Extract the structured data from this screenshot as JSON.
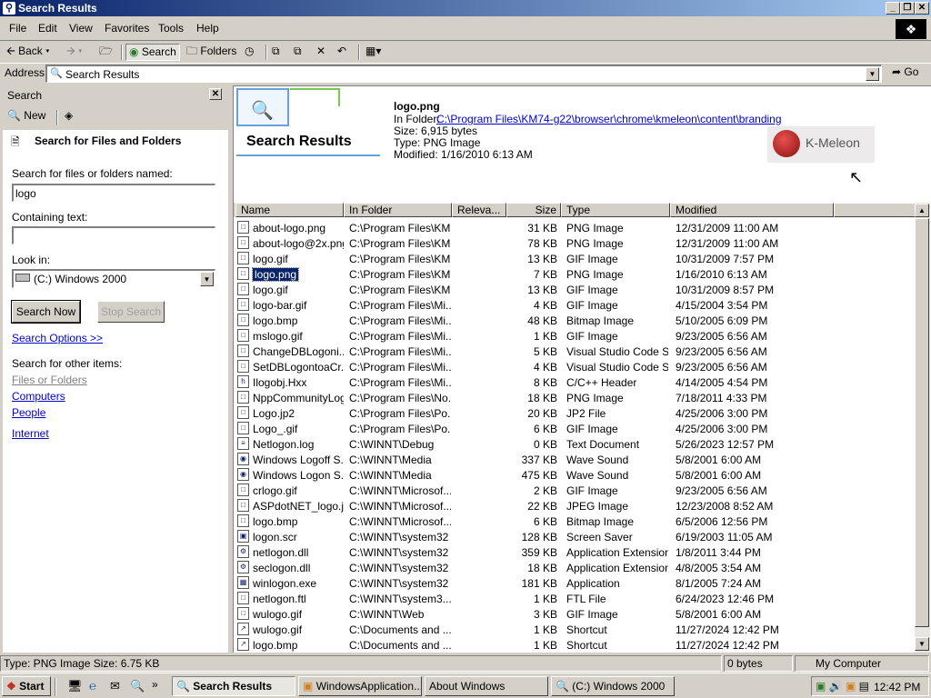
{
  "window": {
    "title": "Search Results"
  },
  "menu": [
    "File",
    "Edit",
    "View",
    "Favorites",
    "Tools",
    "Help"
  ],
  "toolbar": {
    "back": "Back",
    "search": "Search",
    "folders": "Folders"
  },
  "address": {
    "label": "Address",
    "value": "Search Results",
    "go": "Go"
  },
  "search_pane": {
    "header": "Search",
    "new_label": "New",
    "heading": "Search for Files and Folders",
    "named_label": "Search for files or folders named:",
    "named_value": "logo",
    "containing_label": "Containing text:",
    "containing_value": "",
    "lookin_label": "Look in:",
    "lookin_value": "(C:) Windows 2000",
    "search_now": "Search Now",
    "stop_search": "Stop Search",
    "options": "Search Options >>",
    "other_label": "Search for other items:",
    "other_items": [
      "Files or Folders",
      "Computers",
      "People",
      "Internet"
    ]
  },
  "details": {
    "banner": "Search Results",
    "filename": "logo.png",
    "in_folder_label": "In Folder:",
    "in_folder": "C:\\Program Files\\KM74-g22\\browser\\chrome\\kmeleon\\content\\branding",
    "size": "Size: 6,915 bytes",
    "type": "Type: PNG Image",
    "modified": "Modified: 1/16/2010 6:13 AM",
    "preview_text": "K-Meleon"
  },
  "columns": [
    "Name",
    "In Folder",
    "Releva...",
    "Size",
    "Type",
    "Modified"
  ],
  "rows": [
    {
      "name": "about-logo.png",
      "folder": "C:\\Program Files\\KM...",
      "size": "31 KB",
      "type": "PNG Image",
      "modified": "12/31/2009 11:00 AM"
    },
    {
      "name": "about-logo@2x.png",
      "folder": "C:\\Program Files\\KM...",
      "size": "78 KB",
      "type": "PNG Image",
      "modified": "12/31/2009 11:00 AM"
    },
    {
      "name": "logo.gif",
      "folder": "C:\\Program Files\\KM...",
      "size": "13 KB",
      "type": "GIF Image",
      "modified": "10/31/2009 7:57 PM"
    },
    {
      "name": "logo.png",
      "folder": "C:\\Program Files\\KM...",
      "size": "7 KB",
      "type": "PNG Image",
      "modified": "1/16/2010 6:13 AM",
      "selected": true
    },
    {
      "name": "logo.gif",
      "folder": "C:\\Program Files\\KM...",
      "size": "13 KB",
      "type": "GIF Image",
      "modified": "10/31/2009 8:57 PM"
    },
    {
      "name": "logo-bar.gif",
      "folder": "C:\\Program Files\\Mi...",
      "size": "4 KB",
      "type": "GIF Image",
      "modified": "4/15/2004 3:54 PM"
    },
    {
      "name": "logo.bmp",
      "folder": "C:\\Program Files\\Mi...",
      "size": "48 KB",
      "type": "Bitmap Image",
      "modified": "5/10/2005 6:09 PM"
    },
    {
      "name": "mslogo.gif",
      "folder": "C:\\Program Files\\Mi...",
      "size": "1 KB",
      "type": "GIF Image",
      "modified": "9/23/2005 6:56 AM"
    },
    {
      "name": "ChangeDBLogoni...",
      "folder": "C:\\Program Files\\Mi...",
      "size": "5 KB",
      "type": "Visual Studio Code S...",
      "modified": "9/23/2005 6:56 AM"
    },
    {
      "name": "SetDBLogontoaCr...",
      "folder": "C:\\Program Files\\Mi...",
      "size": "4 KB",
      "type": "Visual Studio Code S...",
      "modified": "9/23/2005 6:56 AM"
    },
    {
      "name": "Ilogobj.Hxx",
      "folder": "C:\\Program Files\\Mi...",
      "size": "8 KB",
      "type": "C/C++ Header",
      "modified": "4/14/2005 4:54 PM"
    },
    {
      "name": "NppCommunityLog...",
      "folder": "C:\\Program Files\\No...",
      "size": "18 KB",
      "type": "PNG Image",
      "modified": "7/18/2011 4:33 PM"
    },
    {
      "name": "Logo.jp2",
      "folder": "C:\\Program Files\\Po...",
      "size": "20 KB",
      "type": "JP2 File",
      "modified": "4/25/2006 3:00 PM"
    },
    {
      "name": "Logo_.gif",
      "folder": "C:\\Program Files\\Po...",
      "size": "6 KB",
      "type": "GIF Image",
      "modified": "4/25/2006 3:00 PM"
    },
    {
      "name": "Netlogon.log",
      "folder": "C:\\WINNT\\Debug",
      "size": "0 KB",
      "type": "Text Document",
      "modified": "5/26/2023 12:57 PM"
    },
    {
      "name": "Windows Logoff S...",
      "folder": "C:\\WINNT\\Media",
      "size": "337 KB",
      "type": "Wave Sound",
      "modified": "5/8/2001 6:00 AM"
    },
    {
      "name": "Windows Logon S...",
      "folder": "C:\\WINNT\\Media",
      "size": "475 KB",
      "type": "Wave Sound",
      "modified": "5/8/2001 6:00 AM"
    },
    {
      "name": "crlogo.gif",
      "folder": "C:\\WINNT\\Microsof...",
      "size": "2 KB",
      "type": "GIF Image",
      "modified": "9/23/2005 6:56 AM"
    },
    {
      "name": "ASPdotNET_logo.j...",
      "folder": "C:\\WINNT\\Microsof...",
      "size": "22 KB",
      "type": "JPEG Image",
      "modified": "12/23/2008 8:52 AM"
    },
    {
      "name": "logo.bmp",
      "folder": "C:\\WINNT\\Microsof...",
      "size": "6 KB",
      "type": "Bitmap Image",
      "modified": "6/5/2006 12:56 PM"
    },
    {
      "name": "logon.scr",
      "folder": "C:\\WINNT\\system32",
      "size": "128 KB",
      "type": "Screen Saver",
      "modified": "6/19/2003 11:05 AM"
    },
    {
      "name": "netlogon.dll",
      "folder": "C:\\WINNT\\system32",
      "size": "359 KB",
      "type": "Application Extension",
      "modified": "1/8/2011 3:44 PM"
    },
    {
      "name": "seclogon.dll",
      "folder": "C:\\WINNT\\system32",
      "size": "18 KB",
      "type": "Application Extension",
      "modified": "4/8/2005 3:54 AM"
    },
    {
      "name": "winlogon.exe",
      "folder": "C:\\WINNT\\system32",
      "size": "181 KB",
      "type": "Application",
      "modified": "8/1/2005 7:24 AM"
    },
    {
      "name": "netlogon.ftl",
      "folder": "C:\\WINNT\\system3...",
      "size": "1 KB",
      "type": "FTL File",
      "modified": "6/24/2023 12:46 PM"
    },
    {
      "name": "wulogo.gif",
      "folder": "C:\\WINNT\\Web",
      "size": "3 KB",
      "type": "GIF Image",
      "modified": "5/8/2001 6:00 AM"
    },
    {
      "name": "wulogo.gif",
      "folder": "C:\\Documents and ...",
      "size": "1 KB",
      "type": "Shortcut",
      "modified": "11/27/2024 12:42 PM"
    },
    {
      "name": "logo.bmp",
      "folder": "C:\\Documents and ...",
      "size": "1 KB",
      "type": "Shortcut",
      "modified": "11/27/2024 12:42 PM"
    }
  ],
  "status": {
    "left": "Type: PNG Image Size: 6.75 KB",
    "size": "0 bytes",
    "zone": "My Computer"
  },
  "taskbar": {
    "start": "Start",
    "tasks": [
      "Search Results",
      "WindowsApplication...",
      "About Windows",
      "(C:) Windows 2000"
    ],
    "clock": "12:42 PM"
  }
}
